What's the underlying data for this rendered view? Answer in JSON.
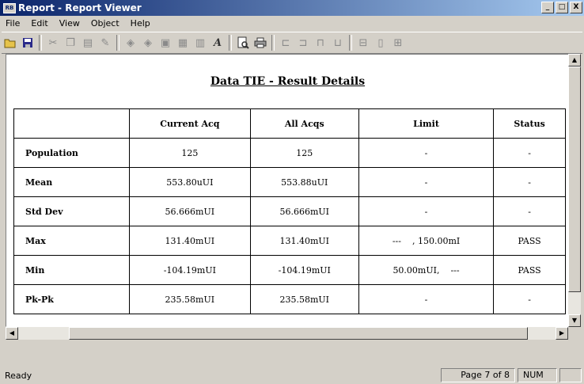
{
  "window": {
    "title": "Report - Report Viewer",
    "icon_text": "RB"
  },
  "window_controls": {
    "minimize": "_",
    "maximize": "□",
    "close": "X"
  },
  "menu": [
    "File",
    "Edit",
    "View",
    "Object",
    "Help"
  ],
  "menu_mnemonics": [
    "F",
    "E",
    "V",
    "O",
    "H"
  ],
  "toolbar_icons": [
    "open-icon",
    "save-icon",
    "cut-icon",
    "copy-icon",
    "paste-icon",
    "draw-icon",
    "object-icon-1",
    "object-icon-2",
    "frame-icon",
    "grid-icon",
    "chart-icon",
    "font-icon",
    "print-preview-icon",
    "print-icon",
    "align-left-icon",
    "align-center-icon",
    "align-right-icon",
    "distribute-icon",
    "size-width-icon",
    "size-height-icon",
    "size-both-icon"
  ],
  "report": {
    "title": "Data TIE - Result Details",
    "columns": [
      "",
      "Current Acq",
      "All Acqs",
      "Limit",
      "Status"
    ],
    "rows": [
      {
        "label": "Population",
        "current": "125",
        "all": "125",
        "limit": "-",
        "status": "-"
      },
      {
        "label": "Mean",
        "current": "553.80uUI",
        "all": "553.88uUI",
        "limit": "-",
        "status": "-"
      },
      {
        "label": "Std Dev",
        "current": "56.666mUI",
        "all": "56.666mUI",
        "limit": "-",
        "status": "-"
      },
      {
        "label": "Max",
        "current": "131.40mUI",
        "all": "131.40mUI",
        "limit": "---    , 150.00mI",
        "status": "PASS"
      },
      {
        "label": "Min",
        "current": "-104.19mUI",
        "all": "-104.19mUI",
        "limit": "50.00mUI,    ---",
        "status": "PASS"
      },
      {
        "label": "Pk-Pk",
        "current": "235.58mUI",
        "all": "235.58mUI",
        "limit": "-",
        "status": "-"
      }
    ]
  },
  "status": {
    "text": "Ready",
    "page": "Page 7 of 8",
    "num": "NUM"
  }
}
